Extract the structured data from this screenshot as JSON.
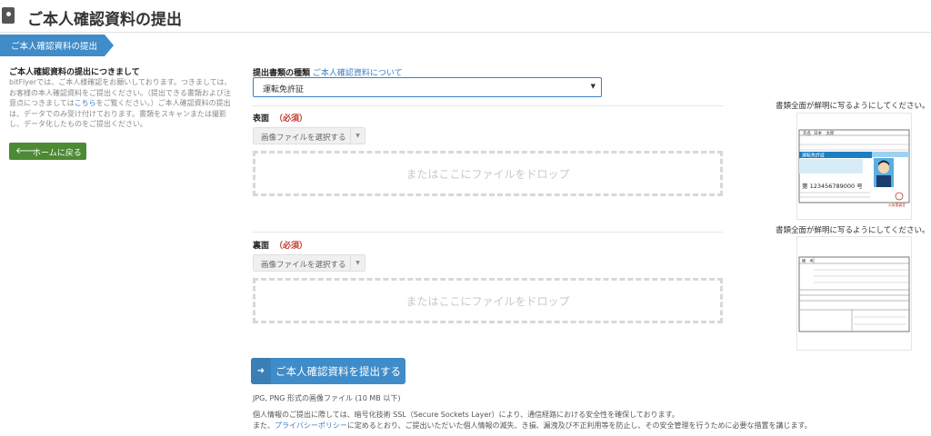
{
  "header": {
    "icon": "id-book-icon",
    "title": "ご本人確認資料の提出"
  },
  "breadcrumb": {
    "label": "ご本人確認資料の提出",
    "color": "#3f8cc9"
  },
  "left": {
    "heading": "ご本人確認資料の提出につきまして",
    "body_1": "bitFlyerでは、ご本人様確認をお願いしております。つきましては、お客様の本人確認資料をご提出ください。（提出できる書類および注意点につきましては",
    "body_link": "こちら",
    "body_2": "をご覧ください。）ご本人確認資料の提出は、データでのみ受け付けております。書類をスキャンまたは撮影し、データ化したものをご提出ください。",
    "home_button": "ホームに戻る",
    "home_icon": "arrow-left-icon"
  },
  "form": {
    "doc_type_label": "提出書類の種類",
    "doc_type_link": "ご本人確認資料について",
    "doc_type_value": "運転免許証",
    "front": {
      "label": "表面",
      "required": "（必須）",
      "file_button": "画像ファイルを選択する",
      "drop_text": "またはここにファイルをドロップ"
    },
    "back": {
      "label": "裏面",
      "required": "（必須）",
      "file_button": "画像ファイルを選択する",
      "drop_text": "またはここにファイルをドロップ"
    },
    "submit_label": "ご本人確認資料を提出する",
    "submit_icon": "arrow-right-icon",
    "format_note": "JPG, PNG 形式の画像ファイル (10 MB 以下)",
    "privacy_1": "個人情報のご提出に際しては、暗号化技術 SSL（Secure Sockets Layer）により、通信経路における安全性を確保しております。",
    "privacy_2a": "また、",
    "privacy_link": "プライバシーポリシー",
    "privacy_2b": "に定めるとおり、ご提出いただいた個人情報の滅失、き損、漏洩及び不正利用等を防止し、その安全管理を行うために必要な措置を講じます。"
  },
  "samples": {
    "front_hint": "書類全面が鮮明に写るようにしてください。",
    "back_hint": "書類全面が鮮明に写るようにしてください。",
    "license": {
      "name_label": "氏名",
      "name_value": "日本　太郎",
      "title": "運転免許証",
      "number": "第 123456789000 号",
      "authority": "公安委員会"
    },
    "reverse_label": "備　考",
    "colors": {
      "blue": "#1a7fc4",
      "red": "#c0392b"
    }
  }
}
